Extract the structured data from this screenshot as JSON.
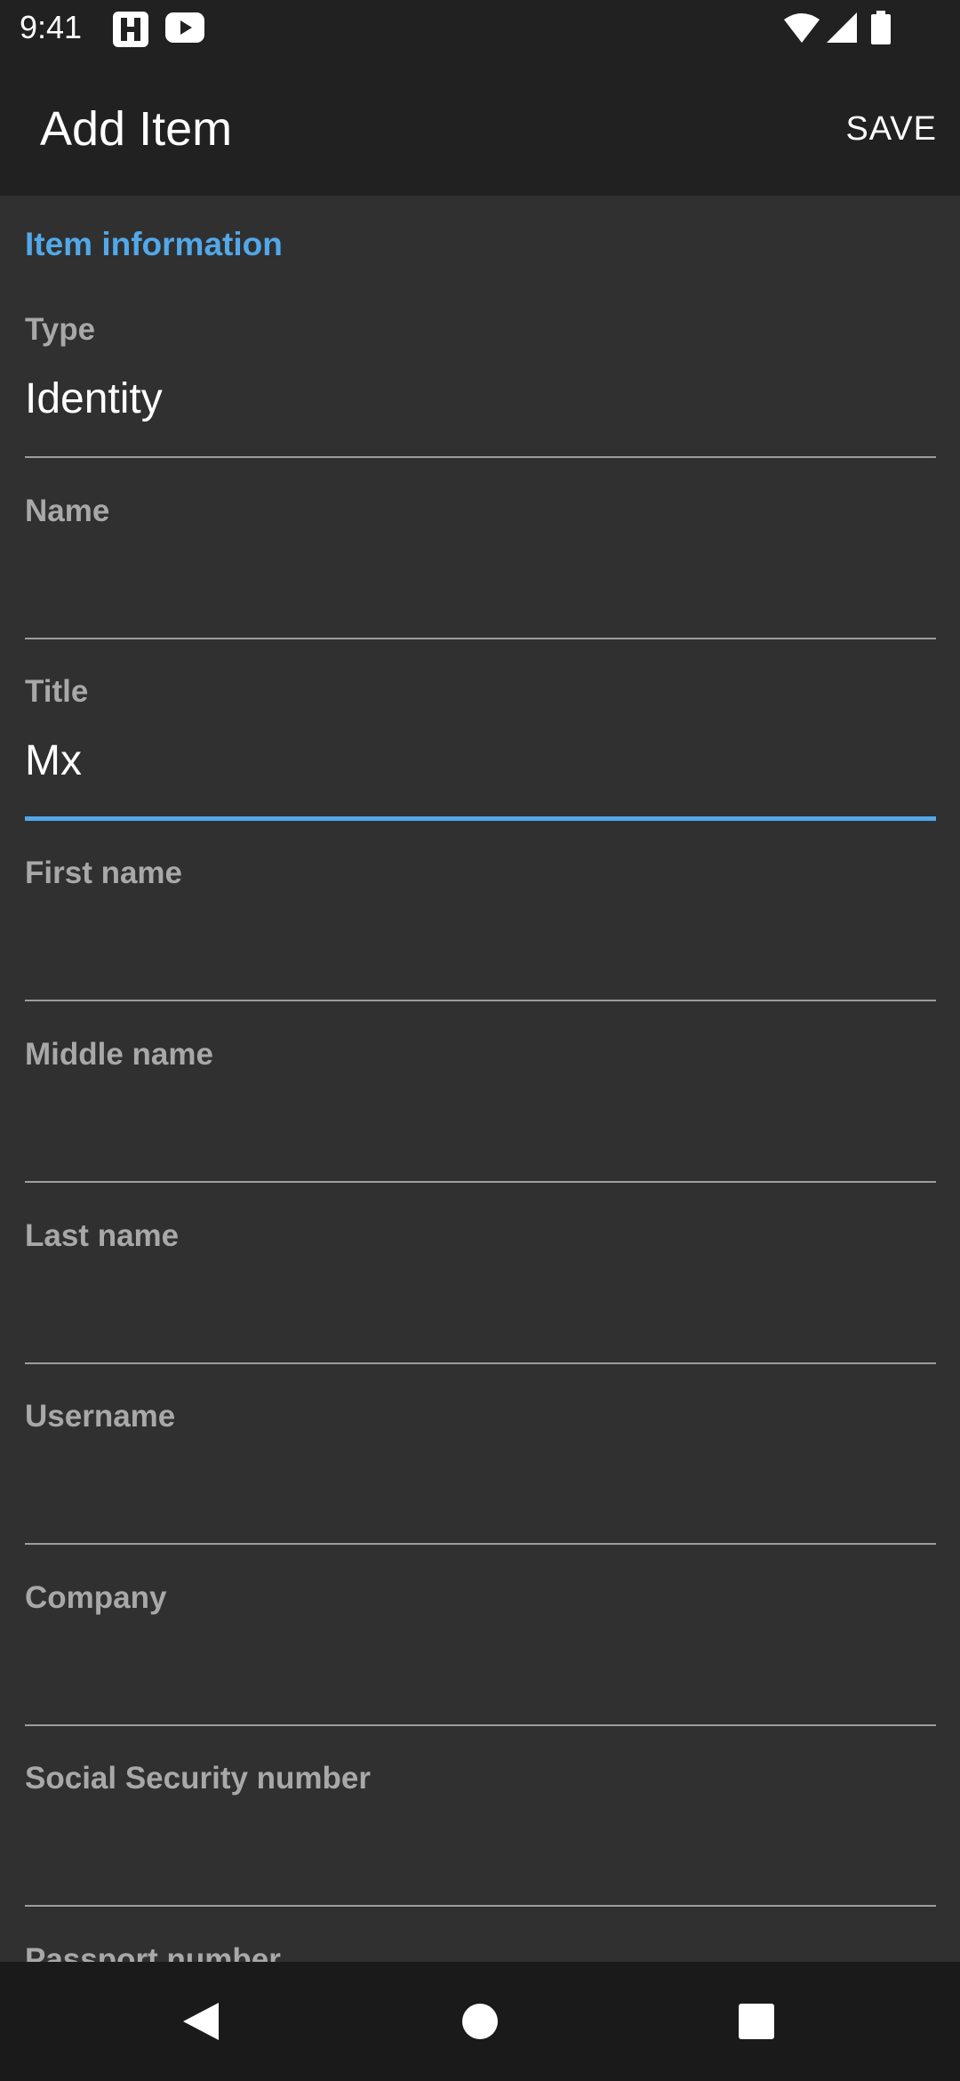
{
  "status_bar": {
    "time": "9:41"
  },
  "toolbar": {
    "title": "Add Item",
    "save_label": "SAVE"
  },
  "section": {
    "header": "Item information"
  },
  "fields": [
    {
      "label": "Type",
      "value": "Identity"
    },
    {
      "label": "Name",
      "value": ""
    },
    {
      "label": "Title",
      "value": "Mx"
    },
    {
      "label": "First name",
      "value": ""
    },
    {
      "label": "Middle name",
      "value": ""
    },
    {
      "label": "Last name",
      "value": ""
    },
    {
      "label": "Username",
      "value": ""
    },
    {
      "label": "Company",
      "value": ""
    },
    {
      "label": "Social Security number",
      "value": ""
    },
    {
      "label": "Passport number",
      "value": ""
    }
  ],
  "colors": {
    "accent": "#52a8e8",
    "background": "#303030",
    "toolbar": "#212121"
  },
  "icons": {
    "status_left": [
      "bitwarden-icon",
      "youtube-icon"
    ],
    "status_right": [
      "wifi-icon",
      "signal-icon",
      "battery-icon"
    ],
    "nav": [
      "back-icon",
      "home-icon",
      "recents-icon"
    ]
  }
}
